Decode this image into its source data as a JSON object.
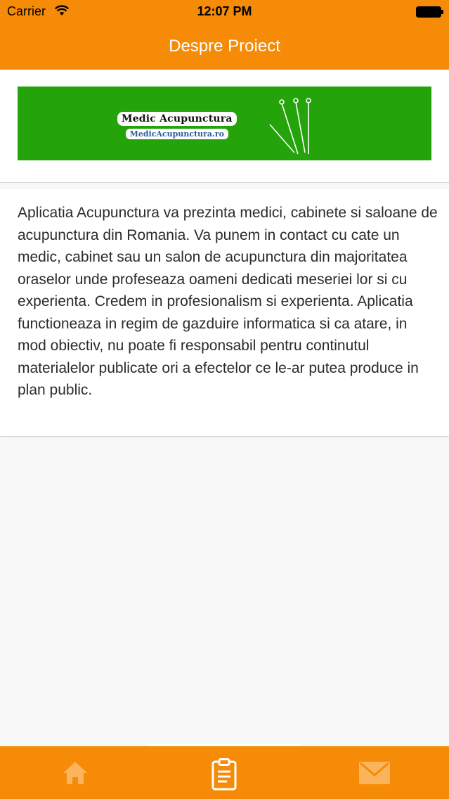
{
  "status_bar": {
    "carrier": "Carrier",
    "time": "12:07 PM"
  },
  "nav": {
    "title": "Despre Proiect"
  },
  "banner": {
    "logo_title": "Medic Acupunctura",
    "logo_url": "MedicAcupunctura.ro",
    "background_color": "#25a30a"
  },
  "content": {
    "description": "Aplicatia Acupunctura va prezinta medici, cabinete si saloane de acupunctura din Romania. Va punem in contact cu cate un medic, cabinet sau un salon de acupunctura din majoritatea oraselor unde profeseaza oameni dedicati meseriei lor si cu experienta.  Credem in profesionalism si experienta. Aplicatia functioneaza in regim de gazduire informatica si ca atare, in mod obiectiv, nu poate fi responsabil pentru continutul materialelor publicate ori a efectelor ce le-ar putea produce in plan public."
  },
  "tab_bar": {
    "tabs": [
      {
        "icon": "home-icon",
        "active": false
      },
      {
        "icon": "clipboard-icon",
        "active": true
      },
      {
        "icon": "mail-icon",
        "active": false
      }
    ]
  },
  "colors": {
    "accent": "#f68b07",
    "inactive_icon": "#fbb45b",
    "active_icon": "#ffffff"
  }
}
